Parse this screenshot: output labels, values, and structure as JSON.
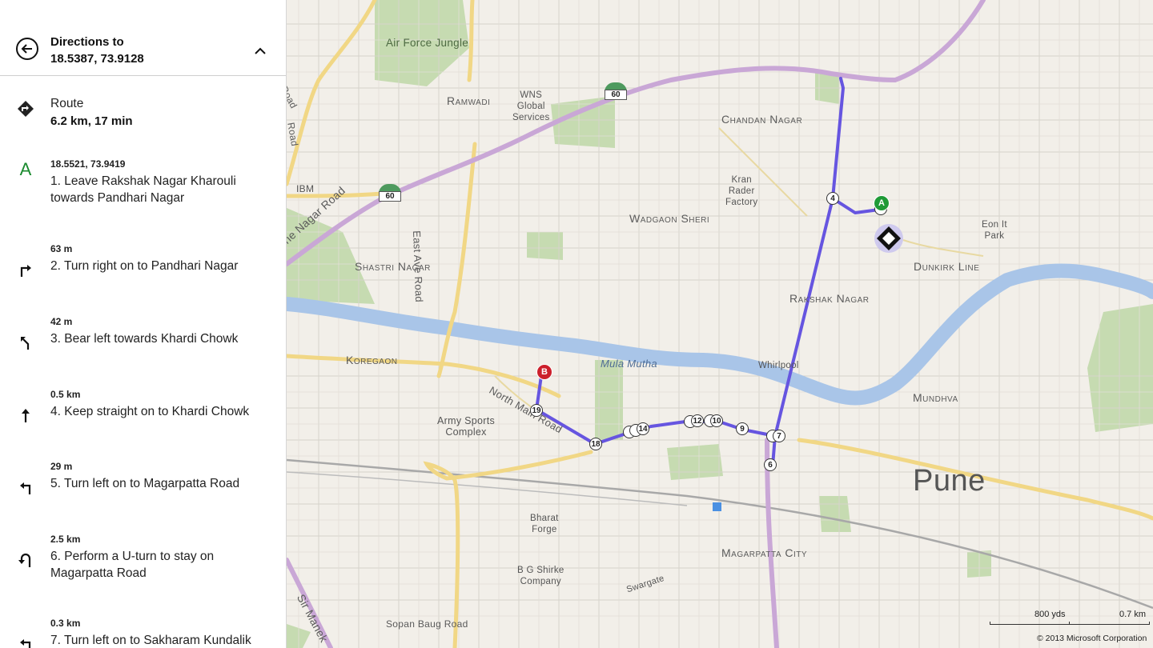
{
  "header": {
    "title": "Directions to",
    "subtitle": "18.5387, 73.9128"
  },
  "route": {
    "label": "Route",
    "summary": "6.2 km, 17 min"
  },
  "steps": [
    {
      "small": "18.5521, 73.9419",
      "text": "1.  Leave Rakshak Nagar Kharouli towards Pandhari Nagar",
      "icon": "start-a-icon"
    },
    {
      "small": "63 m",
      "text": "2.  Turn right on to Pandhari Nagar",
      "icon": "turn-right-icon"
    },
    {
      "small": "42 m",
      "text": "3.  Bear left towards Khardi Chowk",
      "icon": "bear-left-icon"
    },
    {
      "small": "0.5 km",
      "text": "4.  Keep straight on to Khardi Chowk",
      "icon": "straight-icon"
    },
    {
      "small": "29 m",
      "text": "5.  Turn left on to Magarpatta Road",
      "icon": "turn-left-icon"
    },
    {
      "small": "2.5 km",
      "text": "6.  Perform a U-turn to stay on Magarpatta Road",
      "icon": "u-turn-icon"
    },
    {
      "small": "0.3 km",
      "text": "7.  Turn left on to Sakharam Kundalik",
      "icon": "turn-left-icon"
    }
  ],
  "map": {
    "labels": {
      "air_force": "Air Force Jungle",
      "ramwadi": "Ramwadi",
      "wns1": "WNS",
      "wns2": "Global",
      "wns3": "Services",
      "chandan": "Chandan Nagar",
      "kran1": "Kran",
      "kran2": "Rader",
      "kran3": "Factory",
      "ibm": "IBM",
      "wadgaon": "Wadgaon Sheri",
      "shastri": "Shastri Nagar",
      "east_ave": "East Ave Road",
      "nagar_road": "ne Nagar Road",
      "eon1": "Eon It",
      "eon2": "Park",
      "dunkirk": "Dunkirk Line",
      "rakshak": "Rakshak Nagar",
      "koregaon": "Koregaon",
      "mula": "Mula Mutha",
      "whirlpool": "Whirlpool",
      "north_main": "North Main Road",
      "army1": "Army Sports",
      "army2": "Complex",
      "mundhva": "Mundhva",
      "pune": "Pune",
      "bharat1": "Bharat",
      "bharat2": "Forge",
      "bg1": "B G Shirke",
      "bg2": "Company",
      "swargate": "Swargate",
      "magarpatta": "Magarpatta City",
      "sopan": "Sopan Baug Road",
      "sir_manek": "Sir Manek",
      "road_r": "Road",
      "road_p": "Road"
    },
    "highway_shield": "60",
    "waypoints": [
      "4",
      "19",
      "18",
      "14",
      "12",
      "10",
      "9",
      "7",
      "6"
    ],
    "pin_a": "A",
    "pin_b": "B",
    "scale_yds": "800 yds",
    "scale_km": "0.7 km",
    "copyright": "© 2013 Microsoft Corporation",
    "route_color": "#6655e0",
    "highway_color": "#c9a7d6"
  }
}
